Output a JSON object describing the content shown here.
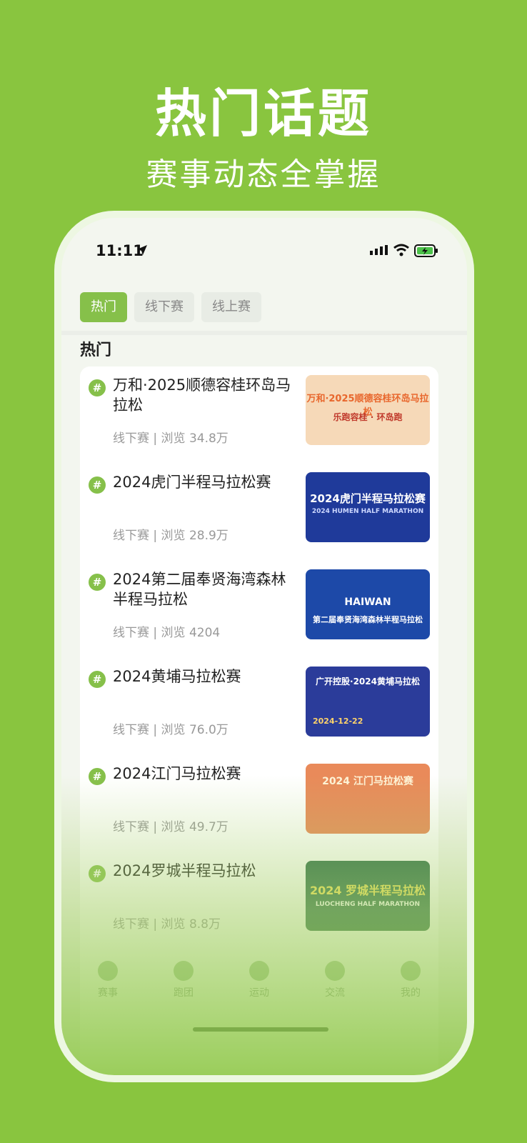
{
  "hero": {
    "title": "热门话题",
    "subtitle": "赛事动态全掌握"
  },
  "status": {
    "time": "11:11"
  },
  "tabs": [
    {
      "label": "热门",
      "active": true
    },
    {
      "label": "线下赛",
      "active": false
    },
    {
      "label": "线上赛",
      "active": false
    }
  ],
  "section_title": "热门",
  "items": [
    {
      "title": "万和·2025顺德容桂环岛马拉松",
      "meta": "线下赛 | 浏览 34.8万",
      "thumb_text": "万和·2025顺德容桂环岛马拉松",
      "thumb_sub": "乐跑容桂 · 环岛跑",
      "thumb_bg": "#f6d9b8",
      "thumb_color": "#e8672d"
    },
    {
      "title": "2024虎门半程马拉松赛",
      "meta": "线下赛 | 浏览 28.9万",
      "thumb_text": "2024虎门半程马拉松赛",
      "thumb_sub": "2024 HUMEN HALF MARATHON",
      "thumb_bg": "#1f3a9a",
      "thumb_color": "#ffffff"
    },
    {
      "title": "2024第二届奉贤海湾森林半程马拉松",
      "meta": "线下赛 | 浏览 4204",
      "thumb_text": "HAIWAN",
      "thumb_sub": "第二届奉贤海湾森林半程马拉松",
      "thumb_bg": "#1d49a8",
      "thumb_color": "#ffffff"
    },
    {
      "title": "2024黄埔马拉松赛",
      "meta": "线下赛 | 浏览 76.0万",
      "thumb_text": "广开控股·2024黄埔马拉松",
      "thumb_sub": "2024-12-22",
      "thumb_bg": "#2b3c9a",
      "thumb_color": "#ffffff"
    },
    {
      "title": "2024江门马拉松赛",
      "meta": "线下赛 | 浏览 49.7万",
      "thumb_text": "2024 江门马拉松赛",
      "thumb_sub": "",
      "thumb_bg": "#e98a5a",
      "thumb_color": "#fff4d8"
    },
    {
      "title": "2024罗城半程马拉松",
      "meta": "线下赛 | 浏览 8.8万",
      "thumb_text": "2024 罗城半程马拉松",
      "thumb_sub": "LUOCHENG HALF MARATHON",
      "thumb_bg": "#2f6e4a",
      "thumb_color": "#f1e25a"
    }
  ],
  "nav": [
    {
      "label": "赛事",
      "icon": "trophy-icon"
    },
    {
      "label": "跑团",
      "icon": "team-icon"
    },
    {
      "label": "运动",
      "icon": "runner-icon"
    },
    {
      "label": "交流",
      "icon": "chat-icon"
    },
    {
      "label": "我的",
      "icon": "smile-icon"
    }
  ],
  "colors": {
    "background": "#89c53f",
    "accent": "#86c04a"
  }
}
